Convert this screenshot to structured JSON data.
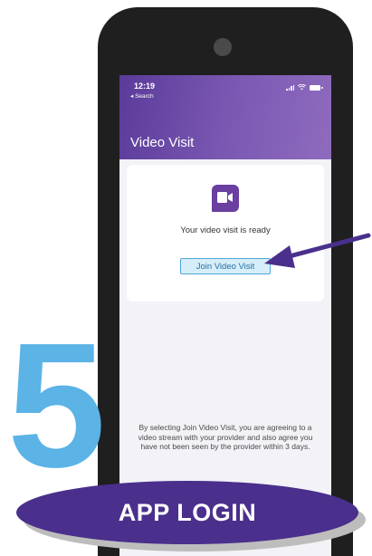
{
  "status_bar": {
    "time": "12:19",
    "back_label": "◂ Search",
    "icons": [
      "signal-icon",
      "wifi-icon",
      "battery-icon"
    ]
  },
  "app_bar": {
    "title": "Video Visit",
    "gradient_colors": [
      "#5b3b9a",
      "#8e6bbd"
    ]
  },
  "video_card": {
    "icon": "video-camera-icon",
    "status_text": "Your video visit is ready",
    "join_button_label": "Join Video Visit"
  },
  "consent_text": "By selecting Join Video Visit, you are agreeing to a video stream with your provider and also agree you have not been seen by the provider within 3 days.",
  "annotation": {
    "step_number": "5",
    "step_label": "APP LOGIN",
    "arrow_color": "#4a2f8c",
    "step_color": "#5bb3e6"
  }
}
